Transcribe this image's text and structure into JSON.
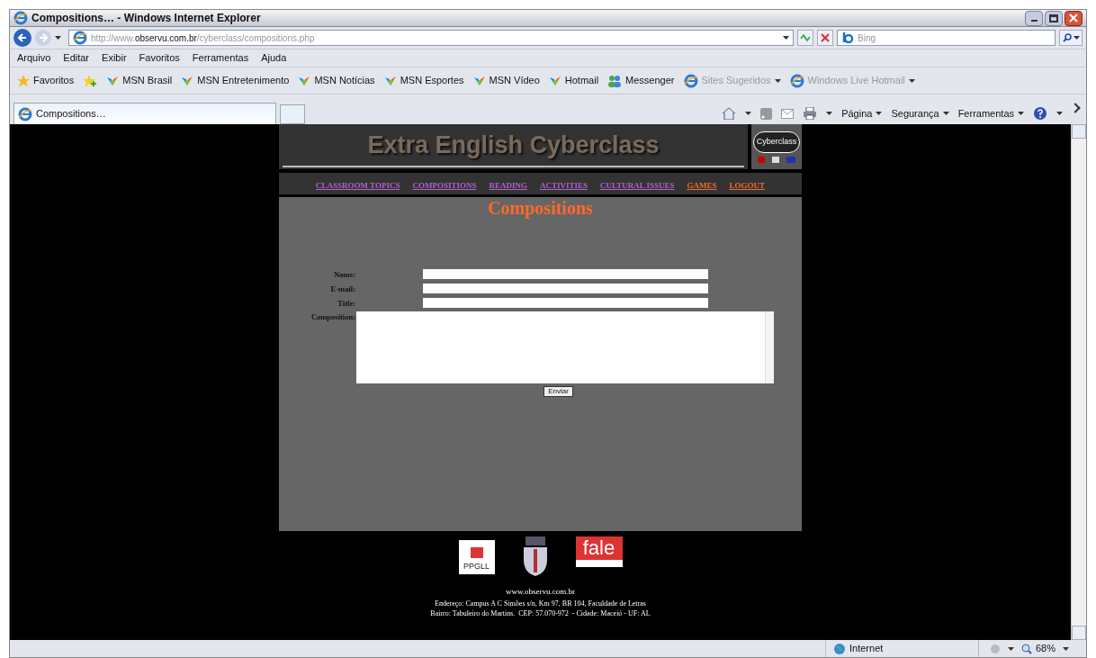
{
  "window": {
    "title": "Compositions… - Windows Internet Explorer"
  },
  "address_bar": {
    "url_prefix": "http://www.",
    "url_host": "observu.com.br",
    "url_path": "/cyberclass/compositions.php",
    "search_placeholder": "Bing"
  },
  "menu": [
    "Arquivo",
    "Editar",
    "Exibir",
    "Favoritos",
    "Ferramentas",
    "Ajuda"
  ],
  "favorites_bar": {
    "label": "Favoritos",
    "items": [
      {
        "label": "MSN Brasil",
        "kind": "msn",
        "dimmed": false
      },
      {
        "label": "MSN Entretenimento",
        "kind": "msn",
        "dimmed": false
      },
      {
        "label": "MSN Notícias",
        "kind": "msn",
        "dimmed": false
      },
      {
        "label": "MSN Esportes",
        "kind": "msn",
        "dimmed": false
      },
      {
        "label": "MSN Vídeo",
        "kind": "msn",
        "dimmed": false
      },
      {
        "label": "Hotmail",
        "kind": "msn",
        "dimmed": false
      },
      {
        "label": "Messenger",
        "kind": "messenger",
        "dimmed": false
      },
      {
        "label": "Sites Sugeridos",
        "kind": "ie",
        "dimmed": true
      },
      {
        "label": "Windows Live Hotmail",
        "kind": "page",
        "dimmed": true
      }
    ]
  },
  "tabs": [
    {
      "label": "Compositions…",
      "selected": true
    }
  ],
  "command_bar": [
    "Página",
    "Segurança",
    "Ferramentas"
  ],
  "page": {
    "site_title": "Extra English Cyberclass",
    "badge_text": "Cyberclass",
    "nav": [
      {
        "label": "CLASSROOM TOPICS",
        "visited": true
      },
      {
        "label": "COMPOSITIONS",
        "visited": true
      },
      {
        "label": "READING",
        "visited": true
      },
      {
        "label": "ACTIVITIES",
        "visited": true
      },
      {
        "label": "CULTURAL ISSUES",
        "visited": true
      },
      {
        "label": "GAMES",
        "visited": false
      },
      {
        "label": "LOGOUT",
        "visited": false
      }
    ],
    "heading": "Compositions",
    "form": {
      "fields": [
        {
          "label": "Name:",
          "kind": "input"
        },
        {
          "label": "E-mail:",
          "kind": "input"
        },
        {
          "label": "Title:",
          "kind": "input"
        },
        {
          "label": "Composition:",
          "kind": "textarea"
        }
      ],
      "submit": "Enviar"
    },
    "logos": [
      {
        "text": "PPGLL",
        "kind": "ppgll"
      },
      {
        "kind": "crest"
      },
      {
        "text": "fale",
        "kind": "fale"
      }
    ],
    "footer": [
      "www.observu.com.br",
      "Endereço: Campus A C Simões s/n, Km 97, BR 104, Faculdade de Letras",
      "Bairro: Tabuleiro do Martins.  CEP: 57.070-972  - Cidade: Maceió - UF: AL"
    ]
  },
  "status_bar": {
    "zone": "Internet",
    "zoom": "68%"
  }
}
